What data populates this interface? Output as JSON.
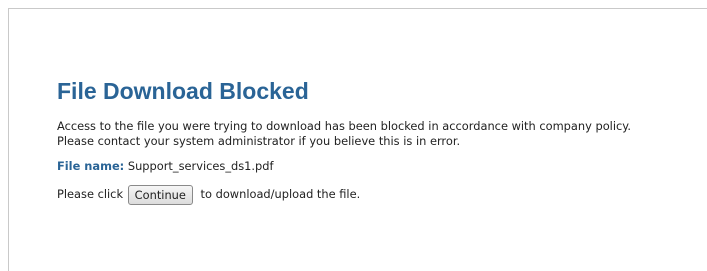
{
  "page": {
    "title": "File Download Blocked",
    "message": "Access to the file you were trying to download has been blocked in accordance with company policy. Please contact your system administrator if you believe this is in error.",
    "file": {
      "label": "File name:",
      "value": "Support_services_ds1.pdf"
    },
    "action": {
      "prefix": "Please click",
      "button_label": "Continue",
      "suffix": "to download/upload the file."
    }
  },
  "colors": {
    "accent": "#2a6496",
    "text": "#222222",
    "background": "#ffffff",
    "border": "#c9c9c9"
  }
}
